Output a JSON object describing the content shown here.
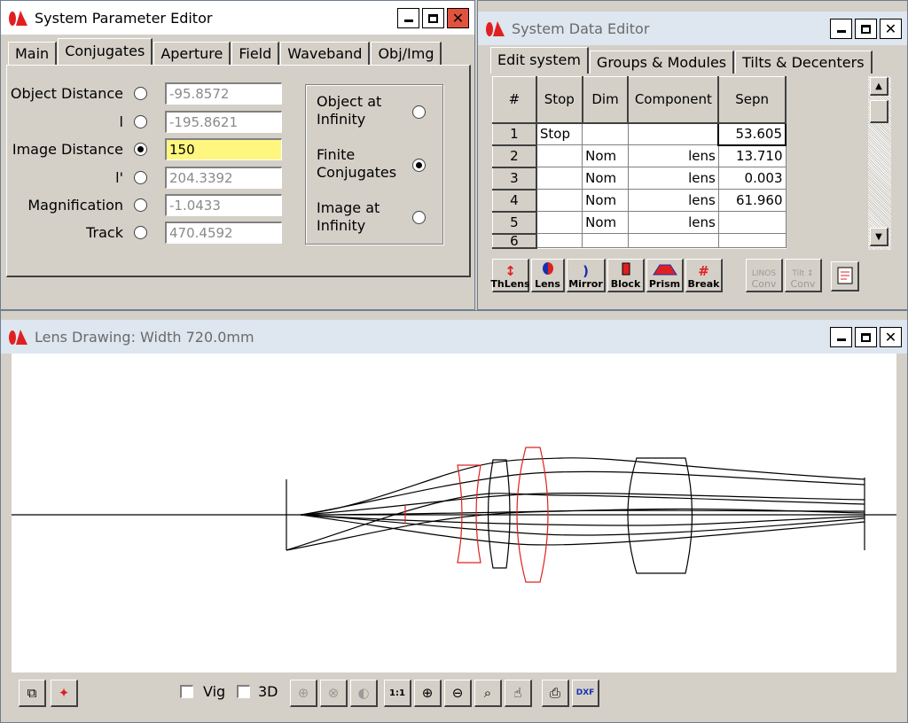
{
  "colors": {
    "accent_red": "#e0533f",
    "lens_red": "#e02020",
    "edit_yellow": "#fff680"
  },
  "spe": {
    "title": "System Parameter Editor",
    "tabs": [
      "Main",
      "Conjugates",
      "Aperture",
      "Field",
      "Waveband",
      "Obj/Img"
    ],
    "selected_tab": "Conjugates",
    "rows": [
      {
        "label": "Object Distance",
        "value": "-95.8572",
        "selected": false
      },
      {
        "label": "l",
        "value": "-195.8621",
        "selected": false
      },
      {
        "label": "Image Distance",
        "value": "150",
        "selected": true
      },
      {
        "label": "l'",
        "value": "204.3392",
        "selected": false
      },
      {
        "label": "Magnification",
        "value": "-1.0433",
        "selected": false
      },
      {
        "label": "Track",
        "value": "470.4592",
        "selected": false
      }
    ],
    "options": [
      {
        "line1": "Object at",
        "line2": "Infinity",
        "selected": false
      },
      {
        "line1": "Finite",
        "line2": "Conjugates",
        "selected": true
      },
      {
        "line1": "Image at",
        "line2": "Infinity",
        "selected": false
      }
    ]
  },
  "sde": {
    "title": "System Data Editor",
    "tabs": [
      "Edit system",
      "Groups & Modules",
      "Tilts & Decenters"
    ],
    "columns": [
      "#",
      "Stop",
      "Dim",
      "Component",
      "Sepn"
    ],
    "rows": [
      {
        "n": "1",
        "stop": "Stop",
        "dim": "",
        "comp": "",
        "sepn": "53.605"
      },
      {
        "n": "2",
        "stop": "",
        "dim": "Nom",
        "comp": "lens",
        "sepn": "13.710"
      },
      {
        "n": "3",
        "stop": "",
        "dim": "Nom",
        "comp": "lens",
        "sepn": "0.003"
      },
      {
        "n": "4",
        "stop": "",
        "dim": "Nom",
        "comp": "lens",
        "sepn": "61.960"
      },
      {
        "n": "5",
        "stop": "",
        "dim": "Nom",
        "comp": "lens",
        "sepn": ""
      },
      {
        "n": "6",
        "stop": "",
        "dim": "",
        "comp": "",
        "sepn": ""
      }
    ],
    "toolbar": [
      {
        "label": "ThLens",
        "icon": "thlens-icon"
      },
      {
        "label": "Lens",
        "icon": "lens-icon"
      },
      {
        "label": "Mirror",
        "icon": "mirror-icon"
      },
      {
        "label": "Block",
        "icon": "block-icon"
      },
      {
        "label": "Prism",
        "icon": "prism-icon"
      },
      {
        "label": "Break",
        "icon": "break-icon"
      },
      {
        "label": "Conv",
        "icon": "linos-icon",
        "top": "LINOS"
      },
      {
        "label": "Conv",
        "icon": "tilt-icon",
        "top": "Tilt"
      }
    ]
  },
  "drawing": {
    "title": "Lens Drawing: Width  720.0mm",
    "vig_label": "Vig",
    "td_label": "3D"
  }
}
